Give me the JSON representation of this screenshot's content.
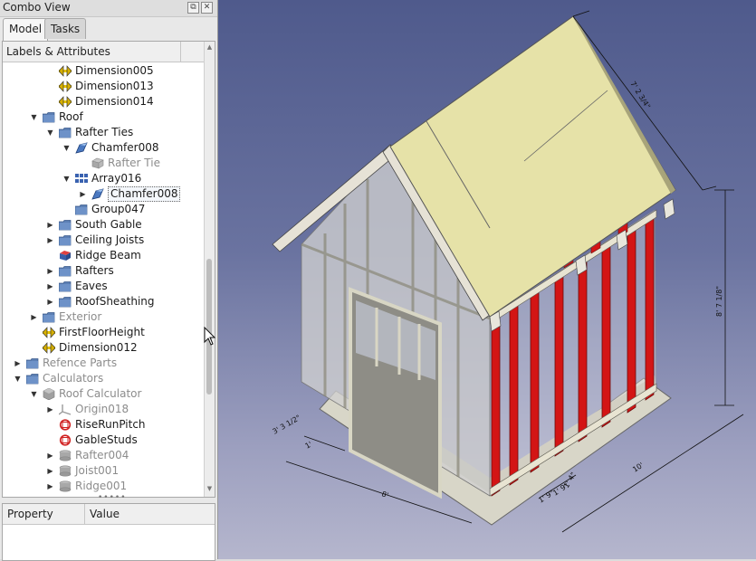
{
  "window": {
    "title": "Combo View"
  },
  "tabs": [
    {
      "label": "Model",
      "active": true
    },
    {
      "label": "Tasks",
      "active": false
    }
  ],
  "tree": {
    "header": "Labels & Attributes",
    "items": [
      {
        "label": "Dimension005",
        "indent": 3,
        "arrow": "",
        "icon": "dimension-icon",
        "dim": false
      },
      {
        "label": "Dimension013",
        "indent": 3,
        "arrow": "",
        "icon": "dimension-icon",
        "dim": false
      },
      {
        "label": "Dimension014",
        "indent": 3,
        "arrow": "",
        "icon": "dimension-icon",
        "dim": false
      },
      {
        "label": "Roof",
        "indent": 2,
        "arrow": "expanded",
        "icon": "folder-icon",
        "dim": false
      },
      {
        "label": "Rafter Ties",
        "indent": 3,
        "arrow": "expanded",
        "icon": "folder-icon",
        "dim": false
      },
      {
        "label": "Chamfer008",
        "indent": 4,
        "arrow": "expanded",
        "icon": "chamfer-icon",
        "dim": false
      },
      {
        "label": "Rafter Tie",
        "indent": 5,
        "arrow": "",
        "icon": "box-icon",
        "dim": true
      },
      {
        "label": "Array016",
        "indent": 4,
        "arrow": "expanded",
        "icon": "array-icon",
        "dim": false
      },
      {
        "label": "Chamfer008",
        "indent": 5,
        "arrow": "collapsed",
        "icon": "chamfer-icon",
        "dim": false,
        "selected": true
      },
      {
        "label": "Group047",
        "indent": 4,
        "arrow": "",
        "icon": "folder-icon",
        "dim": false
      },
      {
        "label": "South Gable",
        "indent": 3,
        "arrow": "collapsed",
        "icon": "folder-icon",
        "dim": false
      },
      {
        "label": "Ceiling Joists",
        "indent": 3,
        "arrow": "collapsed",
        "icon": "folder-icon",
        "dim": false
      },
      {
        "label": "Ridge Beam",
        "indent": 3,
        "arrow": "",
        "icon": "beam-icon",
        "dim": false
      },
      {
        "label": "Rafters",
        "indent": 3,
        "arrow": "collapsed",
        "icon": "folder-icon",
        "dim": false
      },
      {
        "label": "Eaves",
        "indent": 3,
        "arrow": "collapsed",
        "icon": "folder-icon",
        "dim": false
      },
      {
        "label": "RoofSheathing",
        "indent": 3,
        "arrow": "collapsed",
        "icon": "folder-icon",
        "dim": false
      },
      {
        "label": "Exterior",
        "indent": 2,
        "arrow": "collapsed",
        "icon": "folder-icon",
        "dim": true
      },
      {
        "label": "FirstFloorHeight",
        "indent": 2,
        "arrow": "",
        "icon": "dimension-icon",
        "dim": false
      },
      {
        "label": "Dimension012",
        "indent": 2,
        "arrow": "",
        "icon": "dimension-icon",
        "dim": false
      },
      {
        "label": "Refence Parts",
        "indent": 1,
        "arrow": "collapsed",
        "icon": "folder-icon",
        "dim": true
      },
      {
        "label": "Calculators",
        "indent": 1,
        "arrow": "expanded",
        "icon": "folder-icon",
        "dim": true
      },
      {
        "label": "Roof Calculator",
        "indent": 2,
        "arrow": "expanded",
        "icon": "part-icon",
        "dim": true
      },
      {
        "label": "Origin018",
        "indent": 3,
        "arrow": "collapsed",
        "icon": "origin-icon",
        "dim": true
      },
      {
        "label": "RiseRunPitch",
        "indent": 3,
        "arrow": "",
        "icon": "spreadsheet-icon",
        "dim": false
      },
      {
        "label": "GableStuds",
        "indent": 3,
        "arrow": "",
        "icon": "spreadsheet-icon",
        "dim": false
      },
      {
        "label": "Rafter004",
        "indent": 3,
        "arrow": "collapsed",
        "icon": "body-icon",
        "dim": true
      },
      {
        "label": "Joist001",
        "indent": 3,
        "arrow": "collapsed",
        "icon": "body-icon",
        "dim": true
      },
      {
        "label": "Ridge001",
        "indent": 3,
        "arrow": "collapsed",
        "icon": "body-icon",
        "dim": true
      }
    ]
  },
  "properties": {
    "col_property": "Property",
    "col_value": "Value"
  },
  "viewport": {
    "dimension_labels": [
      "7' 2 3/4\"",
      "8' 7 1/8\"",
      "10'",
      "8'",
      "3' 3 1/2\"",
      "1' 9\"",
      "1' 9\"",
      "1' 4\"",
      "1'"
    ],
    "colors": {
      "sheathing": "#e6e2a8",
      "framing": "#e4e0d0",
      "studs_red": "#d01818",
      "wall_translucent": "#d8d8d8"
    }
  }
}
